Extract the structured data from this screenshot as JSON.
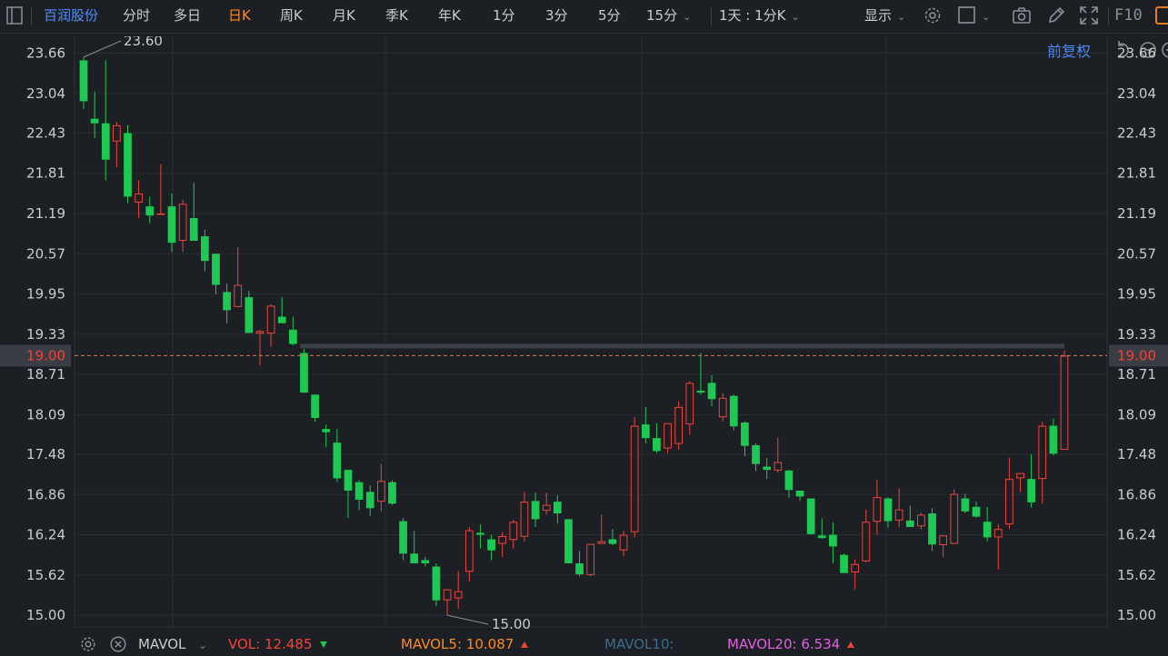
{
  "toolbar": {
    "stock_name": "百润股份",
    "periods": [
      "分时",
      "多日",
      "日K",
      "周K",
      "月K",
      "季K",
      "年K",
      "1分",
      "3分",
      "5分",
      "15分"
    ],
    "active_period": "日K",
    "range_label": "1天 : 1分K",
    "display_label": "显示",
    "f10_label": "F10"
  },
  "price_adjust_label": "前复权",
  "colors": {
    "up": "#f0443b",
    "down": "#1ec953",
    "background": "#1c1f23",
    "accent": "#4d90fe",
    "active": "#ff8a1f"
  },
  "chart_data": {
    "type": "candlestick",
    "y_ticks": [
      "23.66",
      "23.04",
      "22.43",
      "21.81",
      "21.19",
      "20.57",
      "19.95",
      "19.33",
      "18.71",
      "18.09",
      "17.48",
      "16.86",
      "16.24",
      "15.62",
      "15.00"
    ],
    "ylim": [
      14.82,
      23.92
    ],
    "current_price": "19.00",
    "high_label": "23.60",
    "low_label": "15.00",
    "grid": true,
    "candles": [
      {
        "o": 23.55,
        "h": 23.6,
        "l": 22.8,
        "c": 22.92
      },
      {
        "o": 22.65,
        "h": 23.07,
        "l": 22.35,
        "c": 22.58
      },
      {
        "o": 22.58,
        "h": 23.55,
        "l": 21.7,
        "c": 22.02
      },
      {
        "o": 22.3,
        "h": 22.6,
        "l": 21.9,
        "c": 22.55
      },
      {
        "o": 22.43,
        "h": 22.55,
        "l": 21.35,
        "c": 21.45
      },
      {
        "o": 21.36,
        "h": 21.7,
        "l": 21.12,
        "c": 21.5
      },
      {
        "o": 21.3,
        "h": 21.45,
        "l": 21.04,
        "c": 21.16
      },
      {
        "o": 21.19,
        "h": 21.95,
        "l": 21.19,
        "c": 21.19
      },
      {
        "o": 21.3,
        "h": 21.5,
        "l": 20.6,
        "c": 20.74
      },
      {
        "o": 20.77,
        "h": 21.4,
        "l": 20.6,
        "c": 21.34
      },
      {
        "o": 21.12,
        "h": 21.67,
        "l": 20.77,
        "c": 20.77
      },
      {
        "o": 20.84,
        "h": 20.94,
        "l": 20.3,
        "c": 20.46
      },
      {
        "o": 20.57,
        "h": 20.57,
        "l": 19.95,
        "c": 20.09
      },
      {
        "o": 19.98,
        "h": 20.11,
        "l": 19.5,
        "c": 19.7
      },
      {
        "o": 19.75,
        "h": 20.67,
        "l": 19.75,
        "c": 20.09
      },
      {
        "o": 19.9,
        "h": 20.0,
        "l": 19.35,
        "c": 19.35
      },
      {
        "o": 19.34,
        "h": 19.4,
        "l": 18.85,
        "c": 19.38
      },
      {
        "o": 19.34,
        "h": 19.79,
        "l": 19.14,
        "c": 19.77
      },
      {
        "o": 19.6,
        "h": 19.9,
        "l": 19.5,
        "c": 19.5
      },
      {
        "o": 19.4,
        "h": 19.6,
        "l": 19.16,
        "c": 19.18
      },
      {
        "o": 19.04,
        "h": 19.1,
        "l": 18.43,
        "c": 18.43
      },
      {
        "o": 18.4,
        "h": 18.4,
        "l": 17.98,
        "c": 18.04
      },
      {
        "o": 17.87,
        "h": 17.94,
        "l": 17.59,
        "c": 17.82
      },
      {
        "o": 17.66,
        "h": 17.87,
        "l": 17.05,
        "c": 17.11
      },
      {
        "o": 17.24,
        "h": 17.24,
        "l": 16.5,
        "c": 16.92
      },
      {
        "o": 17.05,
        "h": 17.08,
        "l": 16.62,
        "c": 16.78
      },
      {
        "o": 16.9,
        "h": 17.0,
        "l": 16.53,
        "c": 16.65
      },
      {
        "o": 16.75,
        "h": 17.33,
        "l": 16.6,
        "c": 17.07
      },
      {
        "o": 17.05,
        "h": 17.08,
        "l": 16.7,
        "c": 16.72
      },
      {
        "o": 16.45,
        "h": 16.5,
        "l": 15.85,
        "c": 15.95
      },
      {
        "o": 15.95,
        "h": 16.3,
        "l": 15.8,
        "c": 15.8
      },
      {
        "o": 15.85,
        "h": 15.9,
        "l": 15.75,
        "c": 15.8
      },
      {
        "o": 15.75,
        "h": 15.8,
        "l": 15.14,
        "c": 15.23
      },
      {
        "o": 15.23,
        "h": 15.4,
        "l": 15.0,
        "c": 15.4
      },
      {
        "o": 15.26,
        "h": 15.68,
        "l": 15.1,
        "c": 15.37
      },
      {
        "o": 15.67,
        "h": 16.36,
        "l": 15.52,
        "c": 16.31
      },
      {
        "o": 16.27,
        "h": 16.4,
        "l": 16.03,
        "c": 16.24
      },
      {
        "o": 16.17,
        "h": 16.24,
        "l": 15.85,
        "c": 16.0
      },
      {
        "o": 16.1,
        "h": 16.28,
        "l": 15.9,
        "c": 16.22
      },
      {
        "o": 16.16,
        "h": 16.47,
        "l": 16.03,
        "c": 16.44
      },
      {
        "o": 16.21,
        "h": 16.9,
        "l": 16.14,
        "c": 16.75
      },
      {
        "o": 16.76,
        "h": 16.89,
        "l": 16.36,
        "c": 16.48
      },
      {
        "o": 16.61,
        "h": 16.89,
        "l": 16.55,
        "c": 16.7
      },
      {
        "o": 16.75,
        "h": 16.85,
        "l": 16.41,
        "c": 16.57
      },
      {
        "o": 16.48,
        "h": 16.48,
        "l": 15.8,
        "c": 15.8
      },
      {
        "o": 15.8,
        "h": 15.99,
        "l": 15.6,
        "c": 15.63
      },
      {
        "o": 15.62,
        "h": 16.1,
        "l": 15.6,
        "c": 16.1
      },
      {
        "o": 16.1,
        "h": 16.55,
        "l": 16.1,
        "c": 16.14
      },
      {
        "o": 16.17,
        "h": 16.33,
        "l": 16.08,
        "c": 16.1
      },
      {
        "o": 16.0,
        "h": 16.3,
        "l": 15.91,
        "c": 16.24
      },
      {
        "o": 16.28,
        "h": 18.05,
        "l": 16.2,
        "c": 17.92
      },
      {
        "o": 17.94,
        "h": 18.21,
        "l": 17.65,
        "c": 17.73
      },
      {
        "o": 17.73,
        "h": 17.96,
        "l": 17.5,
        "c": 17.53
      },
      {
        "o": 17.57,
        "h": 17.96,
        "l": 17.5,
        "c": 17.96
      },
      {
        "o": 17.64,
        "h": 18.3,
        "l": 17.55,
        "c": 18.21
      },
      {
        "o": 17.94,
        "h": 18.61,
        "l": 17.78,
        "c": 18.58
      },
      {
        "o": 18.46,
        "h": 19.04,
        "l": 18.4,
        "c": 18.43
      },
      {
        "o": 18.58,
        "h": 18.7,
        "l": 18.22,
        "c": 18.33
      },
      {
        "o": 18.05,
        "h": 18.42,
        "l": 17.98,
        "c": 18.35
      },
      {
        "o": 18.38,
        "h": 18.4,
        "l": 17.85,
        "c": 17.91
      },
      {
        "o": 17.97,
        "h": 17.99,
        "l": 17.45,
        "c": 17.61
      },
      {
        "o": 17.62,
        "h": 17.65,
        "l": 17.22,
        "c": 17.33
      },
      {
        "o": 17.29,
        "h": 17.42,
        "l": 17.1,
        "c": 17.24
      },
      {
        "o": 17.23,
        "h": 17.74,
        "l": 17.2,
        "c": 17.36
      },
      {
        "o": 17.23,
        "h": 17.24,
        "l": 16.81,
        "c": 16.93
      },
      {
        "o": 16.92,
        "h": 16.92,
        "l": 16.76,
        "c": 16.83
      },
      {
        "o": 16.8,
        "h": 16.8,
        "l": 16.24,
        "c": 16.25
      },
      {
        "o": 16.23,
        "h": 16.49,
        "l": 16.18,
        "c": 16.19
      },
      {
        "o": 16.24,
        "h": 16.43,
        "l": 15.8,
        "c": 16.06
      },
      {
        "o": 15.93,
        "h": 15.95,
        "l": 15.65,
        "c": 15.65
      },
      {
        "o": 15.66,
        "h": 15.86,
        "l": 15.4,
        "c": 15.79
      },
      {
        "o": 15.83,
        "h": 16.63,
        "l": 15.82,
        "c": 16.44
      },
      {
        "o": 16.44,
        "h": 17.09,
        "l": 16.24,
        "c": 16.82
      },
      {
        "o": 16.8,
        "h": 16.82,
        "l": 16.35,
        "c": 16.45
      },
      {
        "o": 16.46,
        "h": 16.96,
        "l": 16.36,
        "c": 16.63
      },
      {
        "o": 16.46,
        "h": 16.69,
        "l": 16.36,
        "c": 16.36
      },
      {
        "o": 16.37,
        "h": 16.58,
        "l": 16.32,
        "c": 16.55
      },
      {
        "o": 16.57,
        "h": 16.65,
        "l": 15.99,
        "c": 16.09
      },
      {
        "o": 16.08,
        "h": 16.23,
        "l": 15.9,
        "c": 16.23
      },
      {
        "o": 16.1,
        "h": 16.94,
        "l": 16.1,
        "c": 16.87
      },
      {
        "o": 16.8,
        "h": 16.87,
        "l": 16.57,
        "c": 16.6
      },
      {
        "o": 16.67,
        "h": 16.75,
        "l": 16.5,
        "c": 16.52
      },
      {
        "o": 16.44,
        "h": 16.67,
        "l": 16.14,
        "c": 16.2
      },
      {
        "o": 16.2,
        "h": 16.4,
        "l": 15.7,
        "c": 16.33
      },
      {
        "o": 16.4,
        "h": 17.43,
        "l": 16.33,
        "c": 17.1
      },
      {
        "o": 17.11,
        "h": 17.19,
        "l": 16.9,
        "c": 17.19
      },
      {
        "o": 17.1,
        "h": 17.48,
        "l": 16.66,
        "c": 16.74
      },
      {
        "o": 17.1,
        "h": 17.98,
        "l": 16.72,
        "c": 17.92
      },
      {
        "o": 17.92,
        "h": 18.03,
        "l": 17.46,
        "c": 17.49
      },
      {
        "o": 17.55,
        "h": 19.08,
        "l": 17.55,
        "c": 19.0
      }
    ]
  },
  "indicator": {
    "name": "MAVOL",
    "vol_label": "VOL:",
    "vol_value": "12.485",
    "mavol5_label": "MAVOL5:",
    "mavol5_value": "10.087",
    "mavol10_label": "MAVOL10:",
    "mavol20_label": "MAVOL20:",
    "mavol20_value": "6.534"
  }
}
